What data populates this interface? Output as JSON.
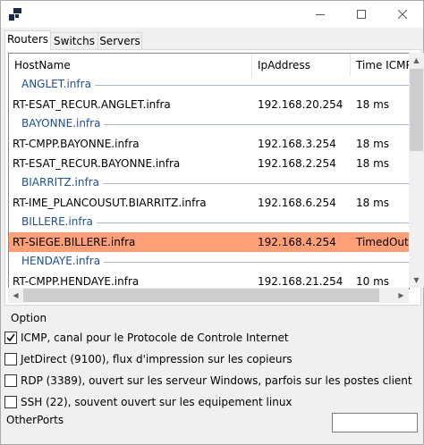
{
  "tabs": [
    "Routers",
    "Switchs",
    "Servers"
  ],
  "active_tab": "Routers",
  "columns": [
    "HostName",
    "IpAddress",
    "Time ICMP"
  ],
  "groups": [
    {
      "name": "ANGLET.infra",
      "rows": [
        {
          "host": "RT-ESAT_RECUR.ANGLET.infra",
          "ip": "192.168.20.254",
          "time": "18 ms"
        }
      ]
    },
    {
      "name": "BAYONNE.infra",
      "rows": [
        {
          "host": "RT-CMPP.BAYONNE.infra",
          "ip": "192.168.3.254",
          "time": "18 ms"
        },
        {
          "host": "RT-ESAT_RECUR.BAYONNE.infra",
          "ip": "192.168.2.254",
          "time": "18 ms"
        }
      ]
    },
    {
      "name": "BIARRITZ.infra",
      "rows": [
        {
          "host": "RT-IME_PLANCOUSUT.BIARRITZ.infra",
          "ip": "192.168.6.254",
          "time": "18 ms"
        }
      ]
    },
    {
      "name": "BILLERE.infra",
      "rows": [
        {
          "host": "RT-SIEGE.BILLERE.infra",
          "ip": "192.168.4.254",
          "time": "TimedOut",
          "status": "error"
        }
      ]
    },
    {
      "name": "HENDAYE.infra",
      "rows": [
        {
          "host": "RT-CMPP.HENDAYE.infra",
          "ip": "192.168.21.254",
          "time": "10 ms"
        }
      ]
    }
  ],
  "colors": {
    "error_row": "#ff9f78",
    "group_text": "#1f4e99"
  },
  "option": {
    "label": "Option",
    "checkboxes": [
      {
        "label": "ICMP, canal pour le Protocole de Controle Internet",
        "checked": true
      },
      {
        "label": "JetDirect (9100), flux d'impression sur les copieurs",
        "checked": false
      },
      {
        "label": "RDP (3389), ouvert sur les serveur Windows, parfois sur les postes client",
        "checked": false
      },
      {
        "label": "SSH (22), souvent ouvert sur les equipement linux",
        "checked": false
      }
    ],
    "other_ports_label": "OtherPorts",
    "other_ports_value": ""
  }
}
